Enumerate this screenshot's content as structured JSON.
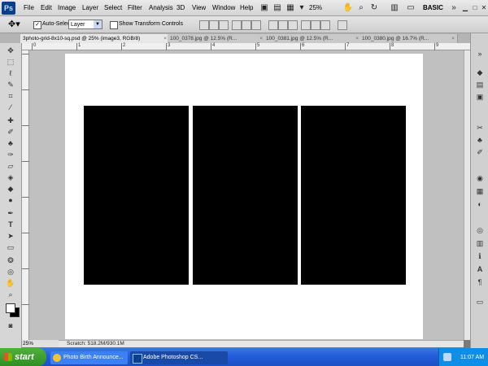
{
  "app": {
    "logo": "Ps",
    "menu": [
      "File",
      "Edit",
      "Image",
      "Layer",
      "Select",
      "Filter",
      "Analysis",
      "3D",
      "View",
      "Window",
      "Help"
    ],
    "zoom": "25%",
    "workspace": "BASIC"
  },
  "options": {
    "auto_select_label": "Auto-Select:",
    "auto_select_value": "Layer",
    "transform_label": "Show Transform Controls"
  },
  "tabs": [
    {
      "label": "3photo-grid-8x10-sq.psd @ 25% (image3, RGB/8)",
      "close": "×"
    },
    {
      "label": "100_0378.jpg @ 12.5% (R...",
      "close": "×"
    },
    {
      "label": "100_0381.jpg @ 12.5% (R...",
      "close": "×"
    },
    {
      "label": "100_0380.jpg @ 16.7% (R...",
      "close": "×"
    }
  ],
  "ruler": {
    "labels": [
      "0",
      "1",
      "2",
      "3",
      "4",
      "5",
      "6",
      "7",
      "8",
      "9"
    ]
  },
  "status": {
    "zoom": "25%",
    "scratch": "Scratch: 518.2M/930.1M"
  },
  "taskbar": {
    "start": "start",
    "tasks": [
      {
        "label": "Photo Birth Announce..."
      },
      {
        "label": "Adobe Photoshop CS..."
      }
    ],
    "clock": "11:07 AM"
  },
  "icons": {
    "tools": [
      "move-icon",
      "marquee-icon",
      "lasso-icon",
      "quick-select-icon",
      "crop-icon",
      "eyedropper-icon",
      "healing-brush-icon",
      "brush-icon",
      "clone-stamp-icon",
      "history-brush-icon",
      "eraser-icon",
      "paint-bucket-icon",
      "blur-icon",
      "dodge-icon",
      "pen-icon",
      "type-icon",
      "path-select-icon",
      "shape-icon",
      "3d-rotate-icon",
      "3d-orbit-icon",
      "hand-icon",
      "zoom-icon"
    ],
    "panels": [
      "layers-icon",
      "channels-icon",
      "paths-icon",
      "tools-presets-icon",
      "clone-source-icon",
      "brushes-icon",
      "styles-icon",
      "swatches-icon",
      "adjustments-icon",
      "masks-icon",
      "histogram-icon",
      "info-icon",
      "character-icon",
      "paragraph-icon",
      "notes-icon"
    ]
  }
}
